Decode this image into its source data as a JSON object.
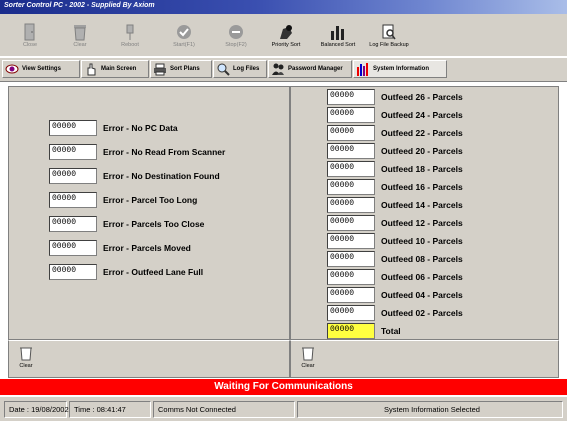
{
  "window": {
    "title": "Sorter Control PC - 2002 - Supplied By Axiom"
  },
  "toolbar": {
    "close": "Close",
    "clear": "Clear",
    "reboot": "Reboot",
    "start": "Start(F1)",
    "stop": "Stop(F2)",
    "priority_sort": "Priority Sort",
    "balanced_sort": "Balanced Sort",
    "log_file_backup": "Log File Backup"
  },
  "tabs": [
    {
      "label": "View Settings"
    },
    {
      "label": "Main Screen"
    },
    {
      "label": "Sort Plans"
    },
    {
      "label": "Log Files"
    },
    {
      "label": "Password Manager"
    },
    {
      "label": "System Information"
    }
  ],
  "errors": [
    {
      "value": "00000",
      "label": "Error - No PC Data"
    },
    {
      "value": "00000",
      "label": "Error - No Read From Scanner"
    },
    {
      "value": "00000",
      "label": "Error - No Destination Found"
    },
    {
      "value": "00000",
      "label": "Error - Parcel Too Long"
    },
    {
      "value": "00000",
      "label": "Error - Parcels Too Close"
    },
    {
      "value": "00000",
      "label": "Error - Parcels Moved"
    },
    {
      "value": "00000",
      "label": "Error - Outfeed Lane Full"
    }
  ],
  "outfeeds": [
    {
      "value": "00000",
      "label": "Outfeed 26 - Parcels"
    },
    {
      "value": "00000",
      "label": "Outfeed 24 - Parcels"
    },
    {
      "value": "00000",
      "label": "Outfeed 22 - Parcels"
    },
    {
      "value": "00000",
      "label": "Outfeed 20 - Parcels"
    },
    {
      "value": "00000",
      "label": "Outfeed 18 - Parcels"
    },
    {
      "value": "00000",
      "label": "Outfeed 16 - Parcels"
    },
    {
      "value": "00000",
      "label": "Outfeed 14 - Parcels"
    },
    {
      "value": "00000",
      "label": "Outfeed 12 - Parcels"
    },
    {
      "value": "00000",
      "label": "Outfeed 10 - Parcels"
    },
    {
      "value": "00000",
      "label": "Outfeed 08 - Parcels"
    },
    {
      "value": "00000",
      "label": "Outfeed 06 - Parcels"
    },
    {
      "value": "00000",
      "label": "Outfeed 04 - Parcels"
    },
    {
      "value": "00000",
      "label": "Outfeed 02 - Parcels"
    }
  ],
  "total": {
    "value": "00000",
    "label": "Total"
  },
  "bottom": {
    "clear_left": "Clear",
    "clear_right": "Clear"
  },
  "banner": {
    "text": "Waiting For Communications",
    "color": "#ff0000"
  },
  "status": {
    "date": "Date : 19/08/2002",
    "time": "Time : 08:41:47",
    "comms": "Comms Not Connected",
    "info": "System Information Selected"
  },
  "colors": {
    "window_bg": "#d4d0c8",
    "title_blue": "#1a2c8c",
    "total_bg": "#ffff40"
  }
}
